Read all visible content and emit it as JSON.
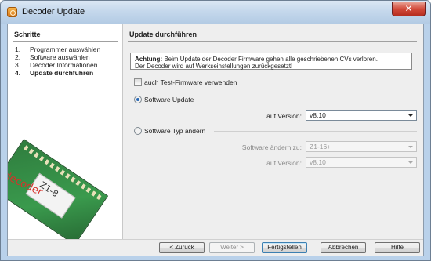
{
  "window": {
    "title": "Decoder Update",
    "close_symbol": "✕"
  },
  "steps": {
    "heading": "Schritte",
    "items": [
      {
        "num": "1.",
        "label": "Programmer auswählen"
      },
      {
        "num": "2.",
        "label": "Software auswählen"
      },
      {
        "num": "3.",
        "label": "Decoder Informationen"
      },
      {
        "num": "4.",
        "label": "Update durchführen"
      }
    ]
  },
  "decoder_image": {
    "chip_label": "Z1-8",
    "brand": "decoder"
  },
  "panel": {
    "heading": "Update durchführen",
    "warning_bold": "Achtung:",
    "warning_text1": " Beim Update der Decoder Firmware gehen alle geschriebenen CVs verloren.",
    "warning_text2": "Der Decoder wird auf Werkseinstellungen zurückgesetzt!",
    "test_firmware_label": "auch Test-Firmware verwenden",
    "software_update_label": "Software Update",
    "version_label": "auf Version:",
    "version_value": "v8.10",
    "change_type_label": "Software Typ ändern",
    "change_to_label": "Software ändern zu:",
    "change_to_value": "Z1-16+",
    "change_version_label": "auf Version:",
    "change_version_value": "v8.10"
  },
  "buttons": {
    "back": "< Zurück",
    "next": "Weiter >",
    "finish": "Fertigstellen",
    "cancel": "Abbrechen",
    "help": "Hilfe"
  }
}
